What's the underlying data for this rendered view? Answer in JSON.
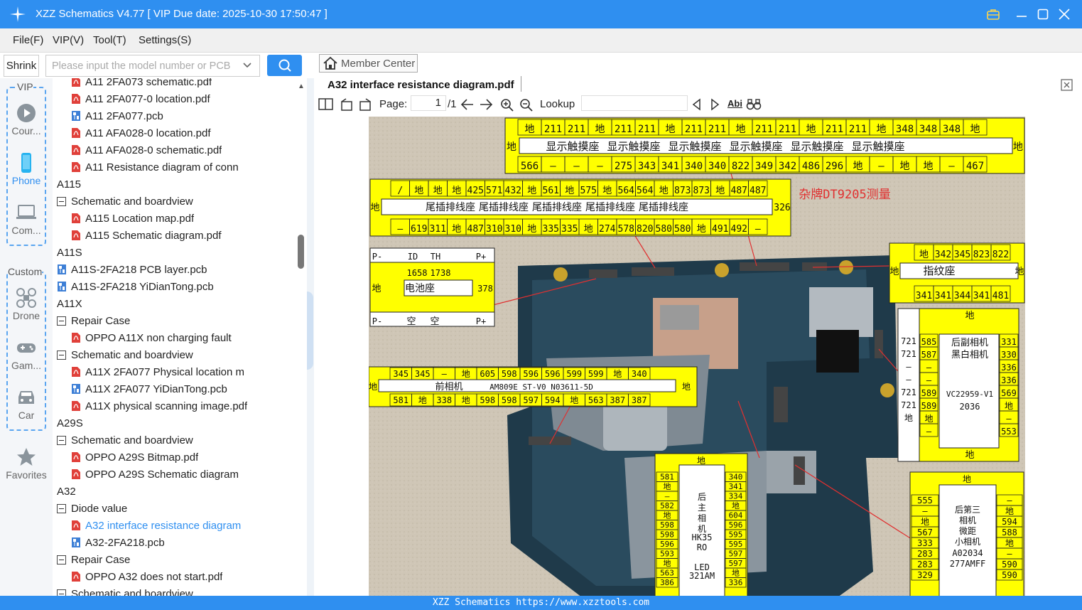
{
  "window": {
    "title": "XZZ Schematics V4.77 [ VIP Due date: 2025-10-30 17:50:47 ]"
  },
  "menu": [
    "File(F)",
    "VIP(V)",
    "Tool(T)",
    "Settings(S)"
  ],
  "search": {
    "shrink_label": "Shrink",
    "placeholder": "Please input the model number or PCB"
  },
  "rail": {
    "vip_label": "VIP",
    "custom_label": "Custom",
    "items": [
      {
        "label": "Cour...",
        "icon": "play-icon"
      },
      {
        "label": "Phone",
        "icon": "phone-icon",
        "active": true
      },
      {
        "label": "Com...",
        "icon": "computer-icon"
      },
      {
        "label": "Drone",
        "icon": "drone-icon"
      },
      {
        "label": "Gam...",
        "icon": "gamepad-icon"
      },
      {
        "label": "Car",
        "icon": "car-icon"
      },
      {
        "label": "Favorites",
        "icon": "star-icon"
      }
    ]
  },
  "tree": [
    {
      "level": 2,
      "type": "pdf",
      "label": "A11 2FA073 schematic.pdf"
    },
    {
      "level": 2,
      "type": "pdf",
      "label": "A11 2FA077-0 location.pdf"
    },
    {
      "level": 2,
      "type": "pcb",
      "label": "A11 2FA077.pcb"
    },
    {
      "level": 2,
      "type": "pdf",
      "label": "A11 AFA028-0 location.pdf"
    },
    {
      "level": 2,
      "type": "pdf",
      "label": "A11 AFA028-0 schematic.pdf"
    },
    {
      "level": 2,
      "type": "pdf",
      "label": "A11 Resistance diagram of conn"
    },
    {
      "level": 0,
      "type": "folder",
      "label": "A115"
    },
    {
      "level": 1,
      "type": "folder",
      "label": "Schematic and boardview"
    },
    {
      "level": 2,
      "type": "pdf",
      "label": "A115 Location map.pdf"
    },
    {
      "level": 2,
      "type": "pdf",
      "label": "A115 Schematic diagram.pdf"
    },
    {
      "level": 0,
      "type": "folder",
      "label": "A11S"
    },
    {
      "level": 1,
      "type": "pcb",
      "label": "A11S-2FA218 PCB layer.pcb"
    },
    {
      "level": 1,
      "type": "pcb",
      "label": "A11S-2FA218 YiDianTong.pcb"
    },
    {
      "level": 0,
      "type": "folder",
      "label": "A11X"
    },
    {
      "level": 1,
      "type": "folder",
      "label": "Repair Case"
    },
    {
      "level": 2,
      "type": "pdf",
      "label": "OPPO A11X non charging fault"
    },
    {
      "level": 1,
      "type": "folder",
      "label": "Schematic and boardview"
    },
    {
      "level": 2,
      "type": "pdf",
      "label": "A11X 2FA077 Physical location m"
    },
    {
      "level": 2,
      "type": "pcb",
      "label": "A11X 2FA077 YiDianTong.pcb"
    },
    {
      "level": 2,
      "type": "pdf",
      "label": "A11X physical scanning image.pdf"
    },
    {
      "level": 0,
      "type": "folder",
      "label": "A29S"
    },
    {
      "level": 1,
      "type": "folder",
      "label": "Schematic and boardview"
    },
    {
      "level": 2,
      "type": "pdf",
      "label": "OPPO A29S Bitmap.pdf"
    },
    {
      "level": 2,
      "type": "pdf",
      "label": "OPPO A29S Schematic diagram"
    },
    {
      "level": 0,
      "type": "folder",
      "label": "A32"
    },
    {
      "level": 1,
      "type": "folder",
      "label": "Diode value"
    },
    {
      "level": 2,
      "type": "pdf",
      "label": "A32 interface resistance diagram",
      "selected": true
    },
    {
      "level": 2,
      "type": "pcb",
      "label": "A32-2FA218.pcb"
    },
    {
      "level": 1,
      "type": "folder",
      "label": "Repair Case"
    },
    {
      "level": 2,
      "type": "pdf",
      "label": "OPPO A32 does not start.pdf"
    },
    {
      "level": 1,
      "type": "folder",
      "label": "Schematic and boardview"
    }
  ],
  "viewer": {
    "member_center": "Member Center",
    "doc_tab": "A32 interface resistance diagram.pdf",
    "page_label": "Page:",
    "page_current": "1",
    "page_total": "/1",
    "lookup_label": "Lookup",
    "abi": "Abi"
  },
  "diagram": {
    "top_row": [
      "地",
      "211",
      "211",
      "地",
      "211",
      "211",
      "地",
      "211",
      "211",
      "地",
      "211",
      "211",
      "地",
      "211",
      "211",
      "地",
      "348",
      "348",
      "348",
      "地"
    ],
    "top_labels": [
      "显示触摸座",
      "显示触摸座",
      "显示触摸座",
      "显示触摸座",
      "显示触摸座",
      "显示触摸座"
    ],
    "top_bottom": [
      "566",
      "—",
      "—",
      "—",
      "275",
      "343",
      "341",
      "340",
      "340",
      "822",
      "349",
      "342",
      "486",
      "296",
      "地",
      "—",
      "地",
      "地",
      "—",
      "467"
    ],
    "tail_top": [
      "/",
      "地",
      "地",
      "地",
      "425",
      "571",
      "432",
      "地",
      "561",
      "地",
      "575",
      "地",
      "564",
      "564",
      "地",
      "873",
      "873",
      "地",
      "487",
      "487"
    ],
    "tail_labels": [
      "尾插排线座",
      "尾插排线座",
      "尾插排线座",
      "尾插排线座",
      "尾插排线座"
    ],
    "tail_side": "326",
    "tail_bottom": [
      "—",
      "619",
      "311",
      "地",
      "487",
      "310",
      "310",
      "地",
      "335",
      "335",
      "地",
      "274",
      "578",
      "820",
      "580",
      "580",
      "地",
      "491",
      "492",
      "—"
    ],
    "red_note": "杂牌DT9205测量",
    "battery": {
      "p_minus": "P-",
      "id": "ID",
      "th": "TH",
      "p_plus": "P+",
      "v1": "1658",
      "v2": "1738",
      "label": "电池座",
      "side": "378",
      "gnd": "地",
      "bot": [
        "空",
        "空"
      ]
    },
    "finger": {
      "top": [
        "地",
        "342",
        "345",
        "823",
        "822"
      ],
      "label": "指纹座",
      "bottom": [
        "341",
        "341",
        "344",
        "341",
        "481"
      ],
      "gnd": "地"
    },
    "front_cam": {
      "top": [
        "345",
        "345",
        "—",
        "地",
        "605",
        "598",
        "596",
        "596",
        "599",
        "599",
        "地",
        "340"
      ],
      "label": "前相机",
      "part": "AM809E ST-V0 N03611-5D",
      "bottom": [
        "581",
        "地",
        "338",
        "地",
        "598",
        "598",
        "597",
        "594",
        "地",
        "563",
        "387",
        "387"
      ],
      "gnd": "地"
    },
    "rear_cam": {
      "gnd": "地",
      "left1": [
        "721",
        "721",
        "—",
        "—",
        "721",
        "721",
        "地"
      ],
      "left2": [
        "585",
        "587",
        "—",
        "—",
        "589",
        "589",
        "地",
        "—"
      ],
      "label1": "后副相机",
      "label2": "黑白相机",
      "part": "VC22959-V1",
      "part2": "2036",
      "right": [
        "331",
        "330",
        "336",
        "336",
        "569",
        "地",
        "—",
        "553"
      ]
    },
    "main_cam": {
      "gnd": "地",
      "left": [
        "581",
        "地",
        "—",
        "582",
        "地",
        "598",
        "598",
        "596",
        "593",
        "地",
        "563",
        "386"
      ],
      "labels": [
        "后",
        "主",
        "相",
        "机",
        "HK35",
        "RO",
        "",
        "LED",
        "321AM"
      ],
      "right": [
        "340",
        "341",
        "334",
        "地",
        "604",
        "596",
        "595",
        "595",
        "597",
        "597",
        "地",
        "336"
      ]
    },
    "third_cam": {
      "gnd": "地",
      "left": [
        "555",
        "—",
        "地",
        "567",
        "333",
        "283",
        "283",
        "329"
      ],
      "labels": [
        "后第三",
        "相机",
        "微距",
        "小相机",
        "A02034",
        "277AMFF"
      ],
      "right": [
        "—",
        "地",
        "594",
        "588",
        "地",
        "—",
        "590",
        "590"
      ]
    }
  },
  "footer": "XZZ Schematics https://www.xzztools.com"
}
